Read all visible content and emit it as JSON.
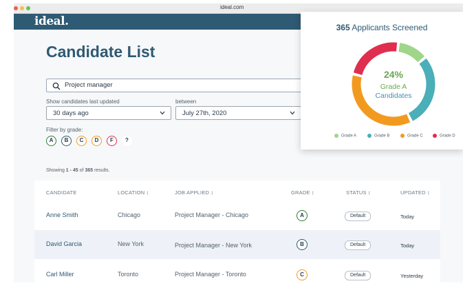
{
  "browser": {
    "url": "ideal.com"
  },
  "app": {
    "logo": "ideal."
  },
  "page": {
    "title": "Candidate List"
  },
  "search": {
    "value": "Project manager"
  },
  "filters": {
    "last_updated_label": "Show candidates last updated",
    "last_updated_value": "30 days ago",
    "between_label": "between",
    "between_value": "July 27th, 2020",
    "grade_label": "Filter by grade:",
    "grades": [
      {
        "label": "A",
        "color": "#2e7d32"
      },
      {
        "label": "B",
        "color": "#2e5a73"
      },
      {
        "label": "C",
        "color": "#f29a1f"
      },
      {
        "label": "D",
        "color": "#f29a1f"
      },
      {
        "label": "F",
        "color": "#d9334a"
      },
      {
        "label": "?",
        "color": "#ffffff"
      }
    ]
  },
  "results": {
    "prefix": "Showing ",
    "range": "1 - 45",
    "middle": " of ",
    "total": "365",
    "suffix": " results."
  },
  "table": {
    "headers": {
      "candidate": "CANDIDATE",
      "location": "LOCATION ↕",
      "job": "JOB APPLIED ↕",
      "grade": "GRADE ↕",
      "status": "STATUS ↕",
      "updated": "UPDATED ↕"
    },
    "rows": [
      {
        "name": "Anne Smith",
        "location": "Chicago",
        "job": "Project Manager - Chicago",
        "grade": "A",
        "grade_color": "#2e7d32",
        "status": "Default",
        "updated": "Today"
      },
      {
        "name": "David Garcia",
        "location": "New York",
        "job": "Project Manager - New York",
        "grade": "B",
        "grade_color": "#2e5a73",
        "status": "Default",
        "updated": "Today"
      },
      {
        "name": "Carl Miller",
        "location": "Toronto",
        "job": "Project Manager - Toronto",
        "grade": "C",
        "grade_color": "#f29a1f",
        "status": "Default",
        "updated": "Yesterday"
      }
    ]
  },
  "card": {
    "count": "365",
    "title_rest": " Applicants Screened",
    "percent": "24%",
    "grade_line": "Grade A",
    "candidates_line": "Candidates"
  },
  "chart_data": {
    "type": "pie",
    "categories": [
      "Grade A",
      "Grade B",
      "Grade C",
      "Grade D"
    ],
    "values": [
      12,
      29,
      36,
      23
    ],
    "colors": [
      "#9fd68a",
      "#4aafb9",
      "#f29a1f",
      "#df2e4e"
    ],
    "center_label": "24%",
    "legend_position": "bottom"
  }
}
